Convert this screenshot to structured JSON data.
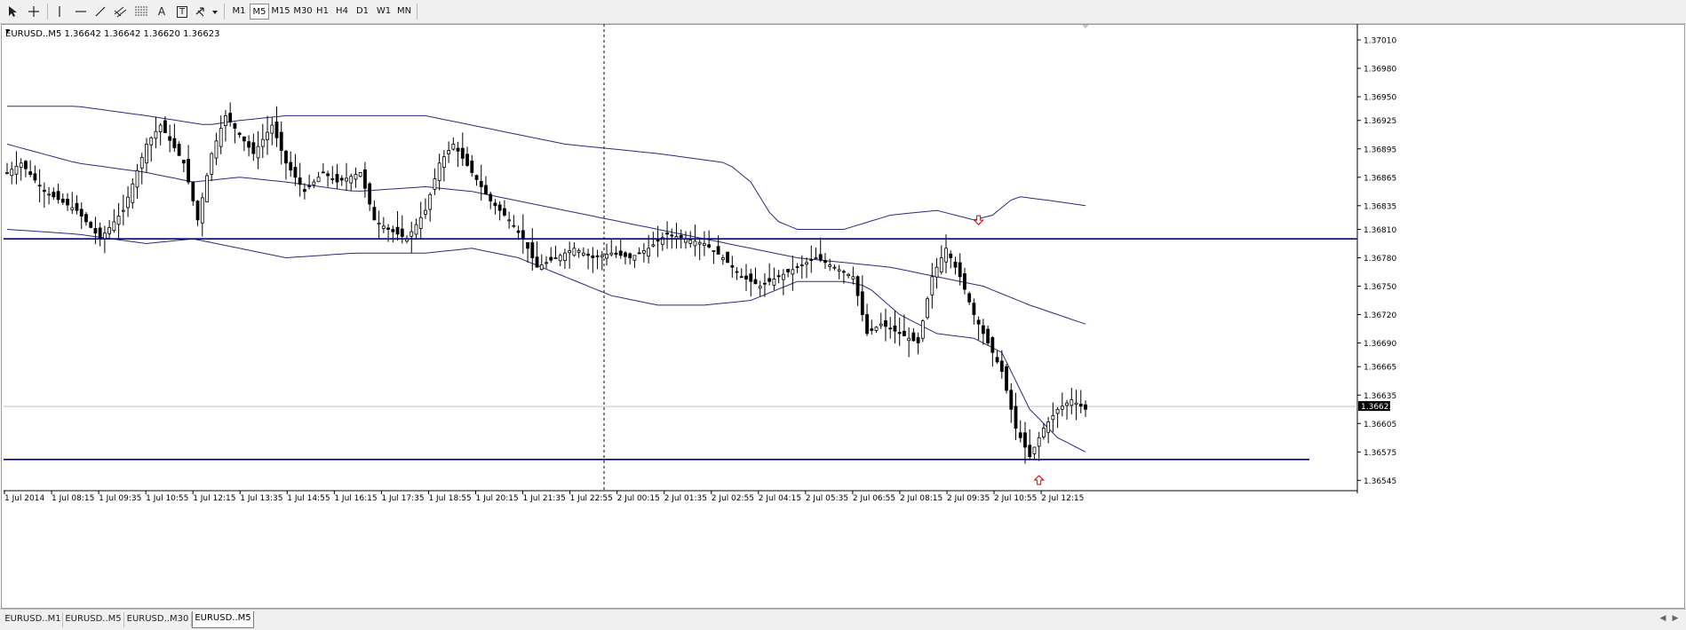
{
  "toolbar": {
    "tools": [
      {
        "name": "cursor-icon"
      },
      {
        "name": "crosshair-icon"
      },
      {
        "name": "vertical-line-icon"
      },
      {
        "name": "horizontal-line-icon"
      },
      {
        "name": "trendline-icon"
      },
      {
        "name": "channel-icon"
      },
      {
        "name": "fibonacci-icon"
      },
      {
        "name": "text-icon",
        "label": "A"
      },
      {
        "name": "text-label-icon",
        "label": "T"
      },
      {
        "name": "arrows-icon"
      }
    ],
    "timeframes": [
      "M1",
      "M5",
      "M15",
      "M30",
      "H1",
      "H4",
      "D1",
      "W1",
      "MN"
    ],
    "active_timeframe": "M5"
  },
  "chart": {
    "header": "EURUSD..M5  1.36642 1.36642 1.36620 1.36623",
    "current_price_label": "1.36623",
    "colors": {
      "candles": "#000000",
      "bands": "#2a2a7a",
      "support_resistance": "#00008b",
      "arrow": "#d00000",
      "price_highlight": "#000000"
    }
  },
  "chart_data": {
    "type": "candlestick",
    "symbol": "EURUSD.",
    "timeframe": "M5",
    "ylim": [
      1.36535,
      1.37025
    ],
    "y_ticks": [
      "1.37010",
      "1.36980",
      "1.36950",
      "1.36925",
      "1.36895",
      "1.36865",
      "1.36835",
      "1.36810",
      "1.36780",
      "1.36750",
      "1.36720",
      "1.36690",
      "1.36665",
      "1.36635",
      "1.36605",
      "1.36575",
      "1.36545"
    ],
    "x_ticks": [
      "1 Jul 2014",
      "1 Jul 08:15",
      "1 Jul 09:35",
      "1 Jul 10:55",
      "1 Jul 12:15",
      "1 Jul 13:35",
      "1 Jul 14:55",
      "1 Jul 16:15",
      "1 Jul 17:35",
      "1 Jul 18:55",
      "1 Jul 20:15",
      "1 Jul 21:35",
      "1 Jul 22:55",
      "2 Jul 00:15",
      "2 Jul 01:35",
      "2 Jul 02:55",
      "2 Jul 04:15",
      "2 Jul 05:35",
      "2 Jul 06:55",
      "2 Jul 08:15",
      "2 Jul 09:35",
      "2 Jul 10:55",
      "2 Jul 12:15"
    ],
    "price_path": [
      [
        0,
        1.3687
      ],
      [
        3,
        1.3688
      ],
      [
        8,
        1.3685
      ],
      [
        15,
        1.3683
      ],
      [
        20,
        1.368
      ],
      [
        25,
        1.3683
      ],
      [
        30,
        1.369
      ],
      [
        33,
        1.3692
      ],
      [
        38,
        1.3688
      ],
      [
        41,
        1.3682
      ],
      [
        44,
        1.3689
      ],
      [
        47,
        1.3693
      ],
      [
        50,
        1.3691
      ],
      [
        53,
        1.3689
      ],
      [
        57,
        1.3692
      ],
      [
        60,
        1.3688
      ],
      [
        64,
        1.3685
      ],
      [
        68,
        1.3687
      ],
      [
        71,
        1.3686
      ],
      [
        76,
        1.3687
      ],
      [
        79,
        1.3682
      ],
      [
        82,
        1.3681
      ],
      [
        86,
        1.368
      ],
      [
        90,
        1.3683
      ],
      [
        93,
        1.3688
      ],
      [
        96,
        1.369
      ],
      [
        100,
        1.3687
      ],
      [
        104,
        1.3684
      ],
      [
        108,
        1.3682
      ],
      [
        111,
        1.368
      ],
      [
        114,
        1.3677
      ],
      [
        118,
        1.3678
      ],
      [
        122,
        1.3679
      ],
      [
        126,
        1.3678
      ],
      [
        130,
        1.36785
      ],
      [
        134,
        1.3678
      ],
      [
        138,
        1.3679
      ],
      [
        142,
        1.36805
      ],
      [
        146,
        1.368
      ],
      [
        150,
        1.36795
      ],
      [
        154,
        1.3678
      ],
      [
        158,
        1.3676
      ],
      [
        162,
        1.3675
      ],
      [
        166,
        1.3676
      ],
      [
        170,
        1.3677
      ],
      [
        174,
        1.3678
      ],
      [
        178,
        1.3677
      ],
      [
        182,
        1.3676
      ],
      [
        185,
        1.367
      ],
      [
        188,
        1.3671
      ],
      [
        192,
        1.367
      ],
      [
        196,
        1.3669
      ],
      [
        199,
        1.3676
      ],
      [
        202,
        1.3679
      ],
      [
        205,
        1.3676
      ],
      [
        208,
        1.3672
      ],
      [
        211,
        1.3669
      ],
      [
        214,
        1.3666
      ],
      [
        217,
        1.366
      ],
      [
        220,
        1.3657
      ],
      [
        223,
        1.366
      ],
      [
        226,
        1.3662
      ],
      [
        229,
        1.3663
      ],
      [
        232,
        1.3662
      ]
    ],
    "bollinger_upper": [
      [
        0,
        1.3694
      ],
      [
        15,
        1.3694
      ],
      [
        30,
        1.3693
      ],
      [
        43,
        1.3692
      ],
      [
        50,
        1.36925
      ],
      [
        60,
        1.3693
      ],
      [
        75,
        1.3693
      ],
      [
        90,
        1.3693
      ],
      [
        100,
        1.3692
      ],
      [
        110,
        1.3691
      ],
      [
        120,
        1.369
      ],
      [
        130,
        1.36895
      ],
      [
        140,
        1.3689
      ],
      [
        155,
        1.3688
      ],
      [
        160,
        1.3686
      ],
      [
        165,
        1.3682
      ],
      [
        170,
        1.3681
      ],
      [
        180,
        1.3681
      ],
      [
        190,
        1.36825
      ],
      [
        200,
        1.3683
      ],
      [
        208,
        1.3682
      ],
      [
        212,
        1.36825
      ],
      [
        217,
        1.36845
      ],
      [
        225,
        1.3684
      ],
      [
        232,
        1.36835
      ]
    ],
    "bollinger_middle": [
      [
        0,
        1.369
      ],
      [
        15,
        1.3688
      ],
      [
        30,
        1.3687
      ],
      [
        40,
        1.3686
      ],
      [
        50,
        1.36865
      ],
      [
        60,
        1.3686
      ],
      [
        75,
        1.3685
      ],
      [
        90,
        1.36855
      ],
      [
        100,
        1.3685
      ],
      [
        110,
        1.3684
      ],
      [
        120,
        1.3683
      ],
      [
        130,
        1.3682
      ],
      [
        140,
        1.3681
      ],
      [
        150,
        1.368
      ],
      [
        160,
        1.3679
      ],
      [
        170,
        1.3678
      ],
      [
        180,
        1.36775
      ],
      [
        190,
        1.3677
      ],
      [
        200,
        1.3676
      ],
      [
        210,
        1.3675
      ],
      [
        220,
        1.3673
      ],
      [
        232,
        1.3671
      ]
    ],
    "bollinger_lower": [
      [
        0,
        1.3681
      ],
      [
        15,
        1.36805
      ],
      [
        30,
        1.36795
      ],
      [
        40,
        1.368
      ],
      [
        50,
        1.3679
      ],
      [
        60,
        1.3678
      ],
      [
        75,
        1.36785
      ],
      [
        90,
        1.36785
      ],
      [
        100,
        1.3679
      ],
      [
        110,
        1.3678
      ],
      [
        120,
        1.3676
      ],
      [
        130,
        1.3674
      ],
      [
        140,
        1.3673
      ],
      [
        150,
        1.3673
      ],
      [
        160,
        1.36735
      ],
      [
        170,
        1.36755
      ],
      [
        180,
        1.36755
      ],
      [
        185,
        1.3675
      ],
      [
        192,
        1.3672
      ],
      [
        200,
        1.367
      ],
      [
        208,
        1.36695
      ],
      [
        214,
        1.3668
      ],
      [
        220,
        1.3662
      ],
      [
        226,
        1.3659
      ],
      [
        232,
        1.36575
      ]
    ],
    "horizontal_lines": [
      1.368,
      1.36567
    ],
    "vertical_line_index": 130,
    "arrows": [
      {
        "dir": "down",
        "index": 209,
        "y": 1.36815
      },
      {
        "dir": "up",
        "index": 222,
        "y": 1.3655
      }
    ],
    "current_price": 1.36623,
    "grid": false
  },
  "tabs": [
    "EURUSD..M1",
    "EURUSD..M5",
    "EURUSD..M30",
    "EURUSD..M5"
  ],
  "active_tab": 3
}
